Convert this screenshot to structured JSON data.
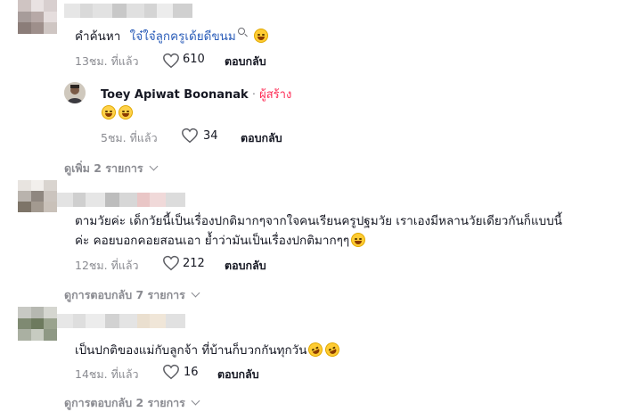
{
  "comments": [
    {
      "text_prefix": "คำค้นหา",
      "text_link": "ใจ๋ใจ๋ลูกครูเด้ยดีขนม",
      "time": "13ชม. ที่แล้ว",
      "likes": "610",
      "reply_label": "ตอบกลับ",
      "emojis": [
        "grinning-sweat-emoji"
      ],
      "avatar_colors": [
        "#cfc4c2",
        "#e9e2e2",
        "#d8cfcf",
        "#a79c9a",
        "#b7a9a7",
        "#e5dddd",
        "#8b7d79",
        "#9e8f8b",
        "#cfc6c3"
      ],
      "name_colors": [
        "#e6e6e6",
        "#d9d9d9",
        "#e2e2e2",
        "#c8c8c8",
        "#e0e0e0",
        "#d4d4d4",
        "#ececec",
        "#d0d0d0"
      ],
      "reply": {
        "author": "Toey Apiwat Boonanak",
        "separator": " · ",
        "author_tag": "ผู้สร้าง",
        "emojis": [
          "grinning-sweat-emoji",
          "grin-emoji"
        ],
        "time": "5ชม. ที่แล้ว",
        "likes": "34",
        "reply_label": "ตอบกลับ"
      },
      "more_label": "ดูเพิ่ม 2 รายการ"
    },
    {
      "line1": "ตามวัยค่ะ เด็กวัยนี้เป็นเรื่องปกติมากๆจากใจคนเรียนครูปฐมวัย เราเองมีหลานวัยเดียวกันก็แบบนี้",
      "line2": "ค่ะ คอยบอกคอยสอนเอา ย้ำว่ามันเป็นเรื่องปกติมากๆๆ",
      "emojis": [
        "smile-emoji"
      ],
      "time": "12ชม. ที่แล้ว",
      "likes": "212",
      "reply_label": "ตอบกลับ",
      "avatar_colors": [
        "#e8e4e0",
        "#f2efec",
        "#d9d4cf",
        "#b9b3ad",
        "#8f8780",
        "#cbc4be",
        "#7d7468",
        "#a39a90",
        "#c9c1b9"
      ],
      "name_colors": [
        "#e3e3e3",
        "#cfcfcf",
        "#e6e6e6",
        "#bdbdbd",
        "#d7d7d7",
        "#e9c6c6",
        "#f0d9d9",
        "#dcdcdc"
      ],
      "more_label": "ดูการตอบกลับ 7 รายการ"
    },
    {
      "text": "เป็นปกติของแม่กับลูกจ้า ที่บ้านก็บวกกันทุกวัน",
      "emojis": [
        "rofl-emoji",
        "rofl-emoji"
      ],
      "time": "14ชม. ที่แล้ว",
      "likes": "16",
      "reply_label": "ตอบกลับ",
      "avatar_colors": [
        "#c8c9c4",
        "#b6b8b1",
        "#d5d6d0",
        "#7f8a72",
        "#6d7a5e",
        "#9aa38e",
        "#aab0a2",
        "#c7cbc1",
        "#8e9884"
      ],
      "name_colors": [
        "#e7e7e7",
        "#dedede",
        "#ececec",
        "#d2d2d2",
        "#e4e4e4",
        "#eadfcf",
        "#f0e6d8",
        "#e1e1e1"
      ],
      "more_label": "ดูการตอบกลับ 2 รายการ"
    }
  ]
}
